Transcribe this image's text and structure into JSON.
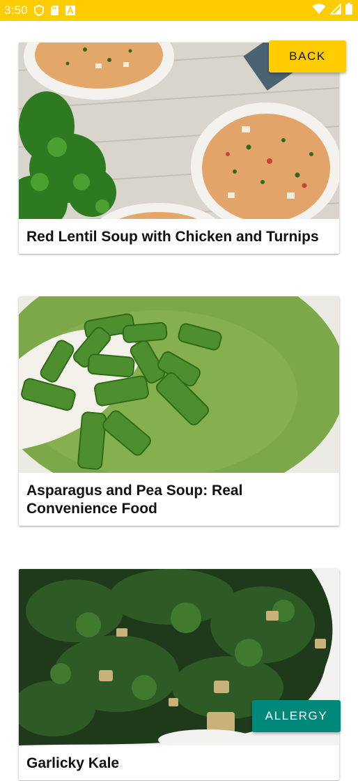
{
  "status_bar": {
    "time": "3:50",
    "background": "#FFCC00",
    "left_icons": [
      "shield-icon",
      "sd-card-icon",
      "font-app-icon"
    ],
    "right_icons": [
      "wifi-icon",
      "signal-icon",
      "battery-icon"
    ]
  },
  "buttons": {
    "back_label": "BACK",
    "allergy_label": "ALLERGY",
    "back_color": "#FFCC00",
    "allergy_color": "#00897B"
  },
  "recipes": [
    {
      "title": "Red Lentil Soup with Chicken and Turnips",
      "image": "lentil-soup-photo"
    },
    {
      "title": "Asparagus and Pea Soup: Real Convenience Food",
      "image": "asparagus-pea-soup-photo"
    },
    {
      "title": "Garlicky Kale",
      "image": "garlicky-kale-photo"
    }
  ]
}
